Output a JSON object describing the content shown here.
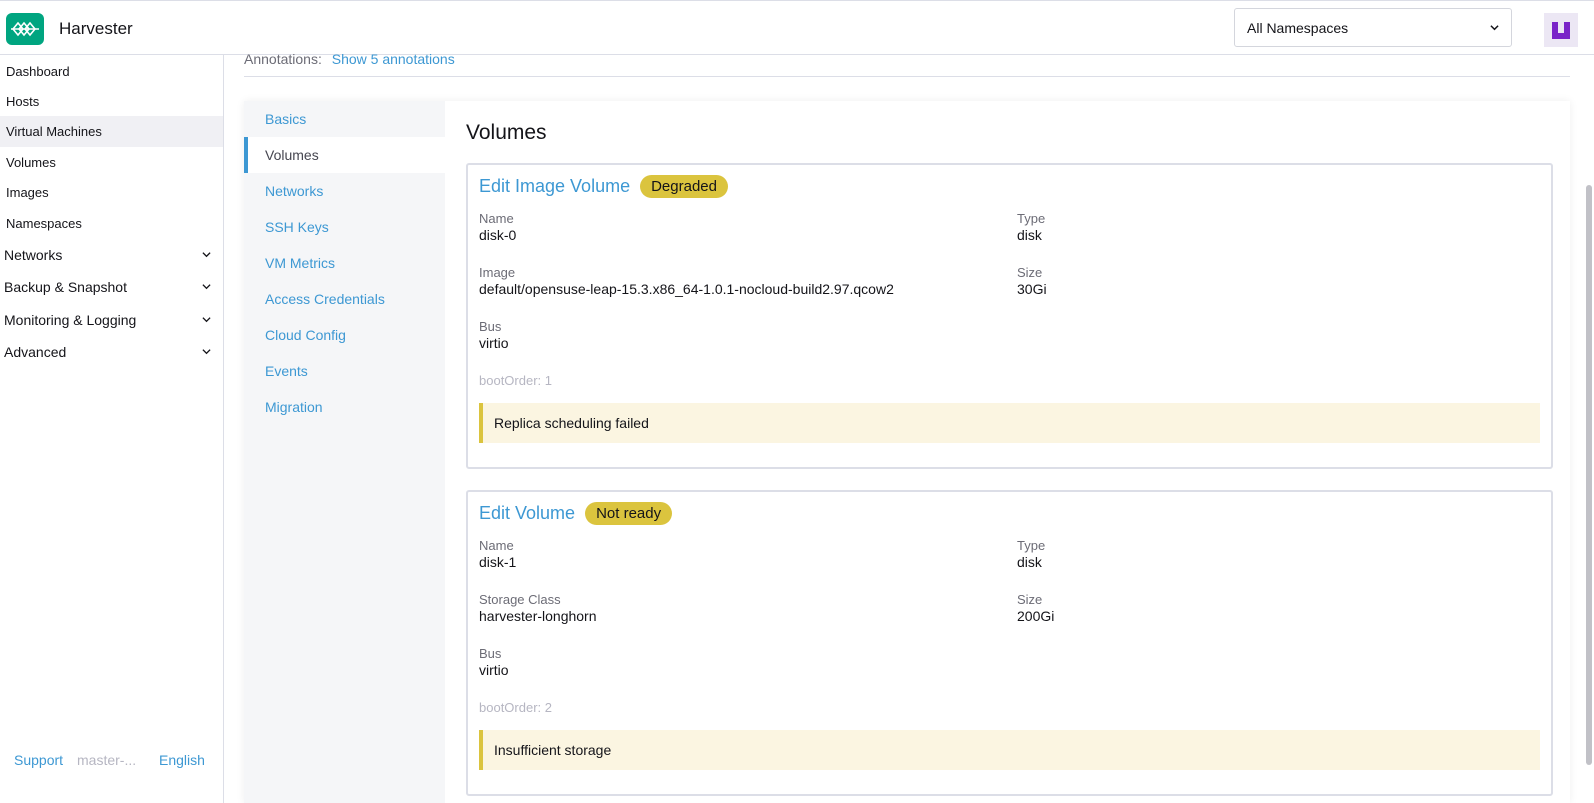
{
  "header": {
    "app_title": "Harvester",
    "namespace_select": "All Namespaces",
    "logo_color": "#00a580"
  },
  "sidebar": {
    "items": [
      {
        "label": "Dashboard"
      },
      {
        "label": "Hosts"
      },
      {
        "label": "Virtual Machines"
      },
      {
        "label": "Volumes"
      },
      {
        "label": "Images"
      },
      {
        "label": "Namespaces"
      }
    ],
    "groups": [
      {
        "label": "Networks"
      },
      {
        "label": "Backup & Snapshot"
      },
      {
        "label": "Monitoring & Logging"
      },
      {
        "label": "Advanced"
      }
    ],
    "footer": {
      "support": "Support",
      "version": "master-...",
      "language": "English"
    }
  },
  "annotations": {
    "label": "Annotations:",
    "link": "Show 5 annotations"
  },
  "tabs": [
    {
      "label": "Basics"
    },
    {
      "label": "Volumes"
    },
    {
      "label": "Networks"
    },
    {
      "label": "SSH Keys"
    },
    {
      "label": "VM Metrics"
    },
    {
      "label": "Access Credentials"
    },
    {
      "label": "Cloud Config"
    },
    {
      "label": "Events"
    },
    {
      "label": "Migration"
    }
  ],
  "section_title": "Volumes",
  "volumes": [
    {
      "title": "Edit Image Volume",
      "badge": "Degraded",
      "name_label": "Name",
      "name": "disk-0",
      "type_label": "Type",
      "type": "disk",
      "second_label": "Image",
      "second": "default/opensuse-leap-15.3.x86_64-1.0.1-nocloud-build2.97.qcow2",
      "size_label": "Size",
      "size": "30Gi",
      "bus_label": "Bus",
      "bus": "virtio",
      "boot": "bootOrder: 1",
      "message": "Replica scheduling failed"
    },
    {
      "title": "Edit Volume",
      "badge": "Not ready",
      "name_label": "Name",
      "name": "disk-1",
      "type_label": "Type",
      "type": "disk",
      "second_label": "Storage Class",
      "second": "harvester-longhorn",
      "size_label": "Size",
      "size": "200Gi",
      "bus_label": "Bus",
      "bus": "virtio",
      "boot": "bootOrder: 2",
      "message": "Insufficient storage"
    }
  ],
  "colors": {
    "accent": "#3d98d3",
    "warning": "#dbc43e",
    "warning_bg": "#fbf5e1",
    "avatar": "#7a24c8"
  }
}
